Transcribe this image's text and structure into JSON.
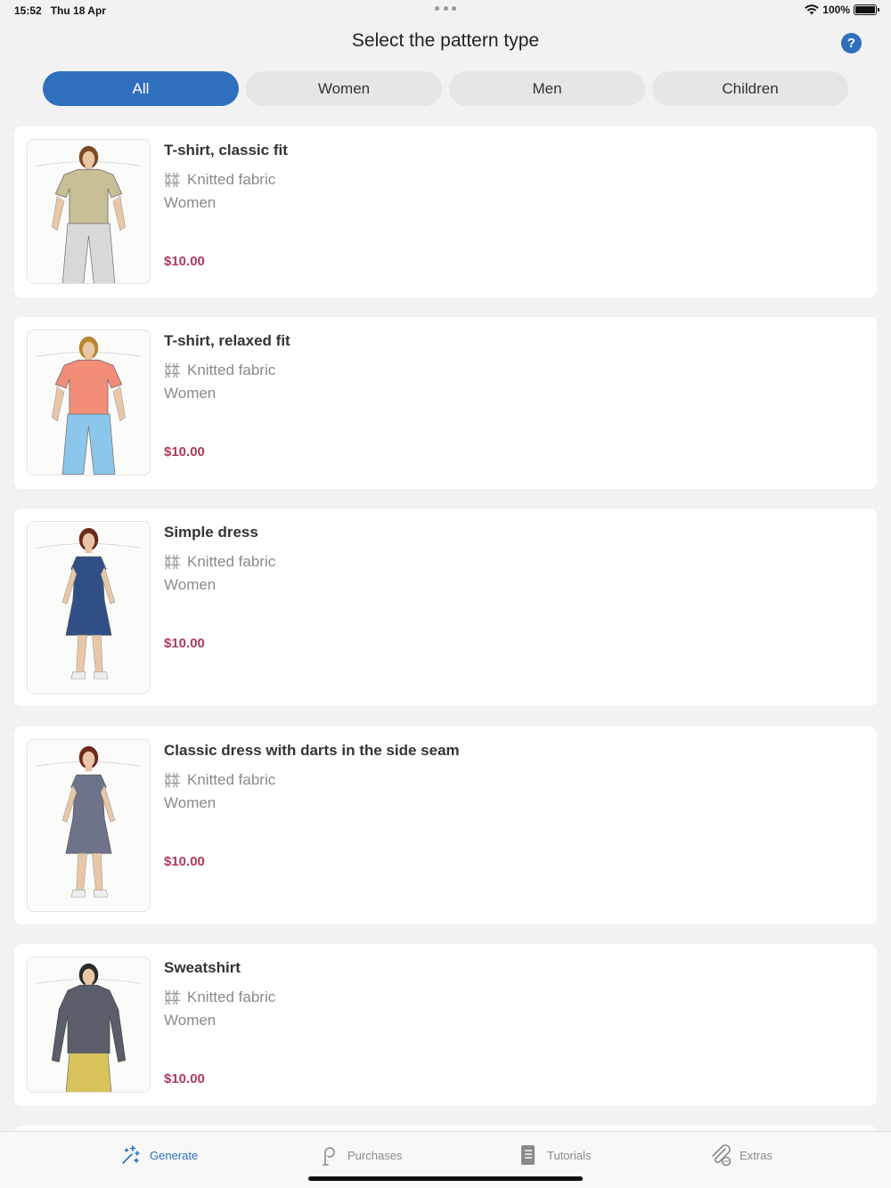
{
  "status_bar": {
    "time": "15:52",
    "date": "Thu 18 Apr",
    "battery": "100%"
  },
  "header": {
    "title": "Select the pattern type",
    "help_label": "?"
  },
  "filters": {
    "tabs": [
      {
        "label": "All",
        "active": true
      },
      {
        "label": "Women",
        "active": false
      },
      {
        "label": "Men",
        "active": false
      },
      {
        "label": "Children",
        "active": false
      }
    ]
  },
  "patterns": [
    {
      "title": "T-shirt, classic fit",
      "fabric": "Knitted fabric",
      "category": "Women",
      "price": "$10.00",
      "figure": {
        "top": "#c9bf96",
        "bottom": "#d9d9dc",
        "hair": "#7a4a24",
        "type": "tshirt"
      }
    },
    {
      "title": "T-shirt, relaxed fit",
      "fabric": "Knitted fabric",
      "category": "Women",
      "price": "$10.00",
      "figure": {
        "top": "#f28e78",
        "bottom": "#8cc6ea",
        "hair": "#b8862e",
        "type": "tshirt"
      }
    },
    {
      "title": "Simple dress",
      "fabric": "Knitted fabric",
      "category": "Women",
      "price": "$10.00",
      "figure": {
        "top": "#2f4f86",
        "bottom": "#2f4f86",
        "hair": "#6b2a1a",
        "type": "dress"
      }
    },
    {
      "title": "Classic dress with darts in the side seam",
      "fabric": "Knitted fabric",
      "category": "Women",
      "price": "$10.00",
      "figure": {
        "top": "#6f7389",
        "bottom": "#6f7389",
        "hair": "#6b2a1a",
        "type": "dress"
      }
    },
    {
      "title": "Sweatshirt",
      "fabric": "Knitted fabric",
      "category": "Women",
      "price": "$10.00",
      "figure": {
        "top": "#5a5e6a",
        "bottom": "#d9c25a",
        "hair": "#2a2a2a",
        "type": "sweat"
      }
    }
  ],
  "tab_bar": {
    "items": [
      {
        "label": "Generate",
        "icon": "sparkles-icon",
        "active": true
      },
      {
        "label": "Purchases",
        "icon": "pattern-tool-icon",
        "active": false
      },
      {
        "label": "Tutorials",
        "icon": "book-icon",
        "active": false
      },
      {
        "label": "Extras",
        "icon": "paperclip-icon",
        "active": false
      }
    ]
  },
  "colors": {
    "accent": "#2f6fbd",
    "price": "#b03a5b",
    "background": "#f2f2f2"
  }
}
